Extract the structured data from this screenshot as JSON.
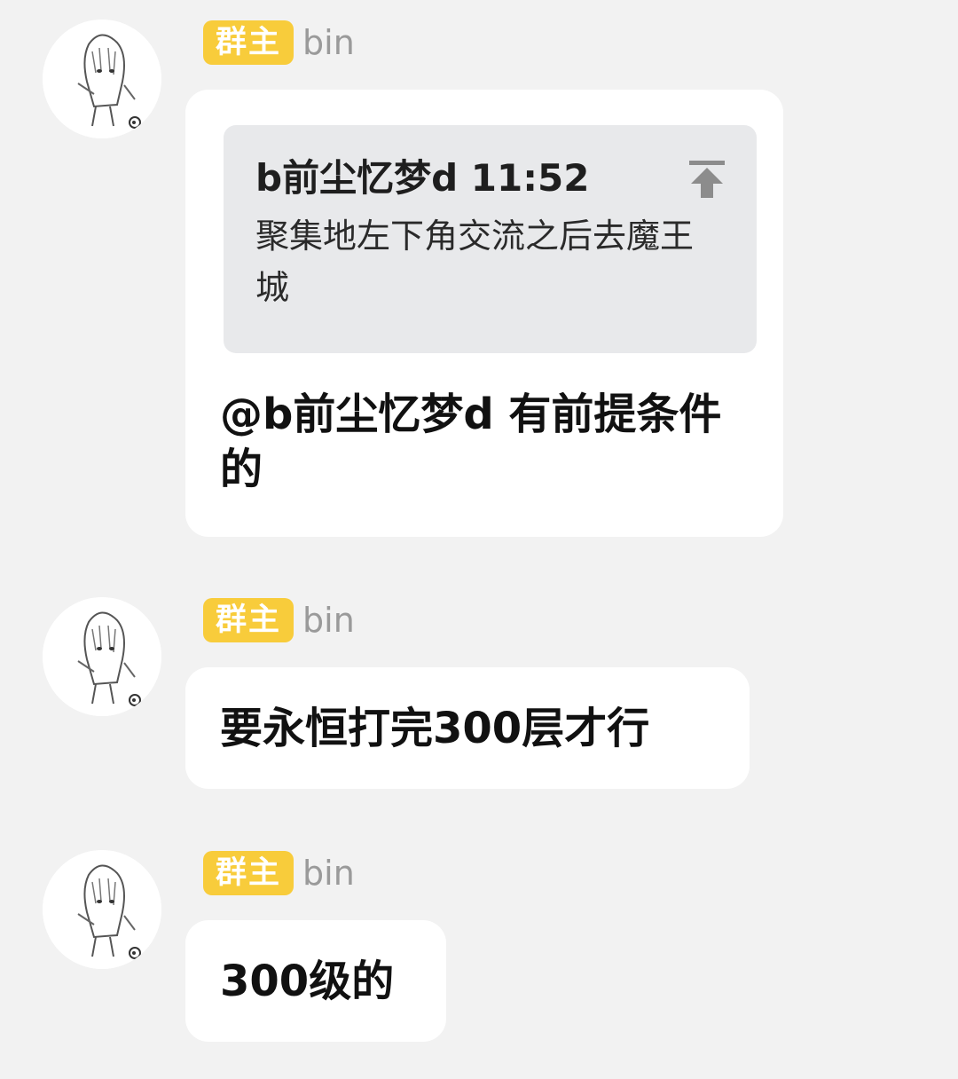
{
  "messages": [
    {
      "role_badge": "群主",
      "sender": "bin",
      "quote": {
        "author": "b前尘忆梦d",
        "time": "11:52",
        "text": "聚集地左下角交流之后去魔王城",
        "jump_icon": "jump-to-top-icon"
      },
      "text": "@b前尘忆梦d 有前提条件的"
    },
    {
      "role_badge": "群主",
      "sender": "bin",
      "text": "要永恒打完300层才行"
    },
    {
      "role_badge": "群主",
      "sender": "bin",
      "text": "300级的"
    }
  ],
  "colors": {
    "background": "#f2f2f2",
    "bubble": "#ffffff",
    "badge": "#f8cc3b",
    "quote_bg": "#e8e9eb",
    "sender_name": "#9a9a9a"
  }
}
